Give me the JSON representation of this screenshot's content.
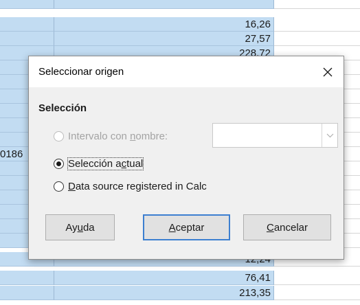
{
  "sheet": {
    "column_b_values": {
      "r1": "16,26",
      "r2": "27,57",
      "r3": "228,72",
      "r16": "12,24",
      "r17": "76,41",
      "r18": "213,35"
    },
    "column_a_partial": "0186"
  },
  "dialog": {
    "title": "Seleccionar origen",
    "section_label": "Selección",
    "options": {
      "named_range": {
        "pre": "Intervalo con ",
        "key": "n",
        "post": "ombre:"
      },
      "current_selection": {
        "pre": "Selección a",
        "key": "c",
        "post": "tual"
      },
      "data_source": {
        "pre": "",
        "key": "D",
        "post": "ata source registered in Calc"
      }
    },
    "combo_value": "",
    "buttons": {
      "help": {
        "pre": "Ay",
        "key": "u",
        "post": "da"
      },
      "ok": {
        "pre": "",
        "key": "A",
        "post": "ceptar"
      },
      "cancel": {
        "pre": "",
        "key": "C",
        "post": "ancelar"
      }
    }
  },
  "colors": {
    "selection_fill": "#c2dcf2",
    "dialog_content_bg": "#f0f0f0",
    "default_button_border": "#3c7fd0",
    "button_bg": "#e1e1e1"
  },
  "icons": {
    "close": "close-icon",
    "dropdown": "chevron-down-icon"
  }
}
